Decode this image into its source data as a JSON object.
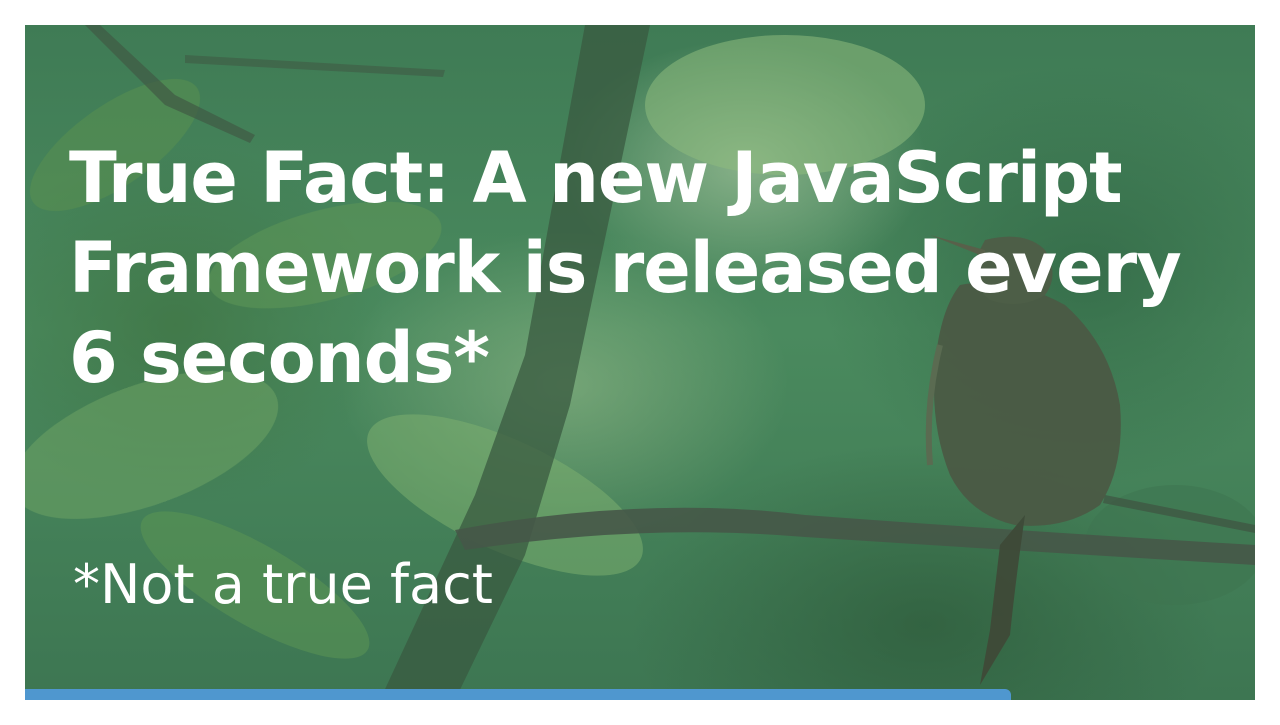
{
  "slide": {
    "title": "True Fact: A new JavaScript Framework is released every 6 seconds*",
    "footnote": "*Not a true fact",
    "background_image": "bird-on-branch-photo",
    "progress": 0.802,
    "progress_color": "#4f97cf",
    "text_color": "#ffffff"
  }
}
